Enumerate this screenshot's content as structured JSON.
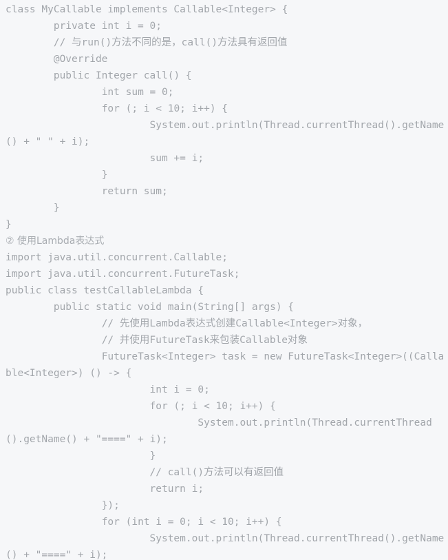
{
  "viewer": {
    "background_color": "#f6f7f9",
    "text_color": "#a2a6ab"
  },
  "blocks": {
    "callable_class_code": "class MyCallable implements Callable<Integer> {\n\tprivate int i = 0;\n\t// 与run()方法不同的是，call()方法具有返回值\n\t@Override\n\tpublic Integer call() {\n\t\tint sum = 0;\n\t\tfor (; i < 10; i++) {\n\t\t\tSystem.out.println(Thread.currentThread().getName() + \" \" + i);\n\t\t\tsum += i;\n\t\t}\n\t\treturn sum;\n\t}\n}",
    "section_two_label": "② 使用Lambda表达式",
    "lambda_code": "import java.util.concurrent.Callable;\nimport java.util.concurrent.FutureTask;\npublic class testCallableLambda {\n\tpublic static void main(String[] args) {\n\t\t// 先使用Lambda表达式创建Callable<Integer>对象，\n\t\t// 并使用FutureTask来包装Callable对象\n\t\tFutureTask<Integer> task = new FutureTask<Integer>((Callable<Integer>) () -> {\n\t\t\tint i = 0;\n\t\t\tfor (; i < 10; i++) {\n\t\t\t\tSystem.out.println(Thread.currentThread().getName() + \"====\" + i);\n\t\t\t}\n\t\t\t// call()方法可以有返回值\n\t\t\treturn i;\n\t\t});\n\t\tfor (int i = 0; i < 10; i++) {\n\t\t\tSystem.out.println(Thread.currentThread().getName() + \"====\" + i);"
  }
}
